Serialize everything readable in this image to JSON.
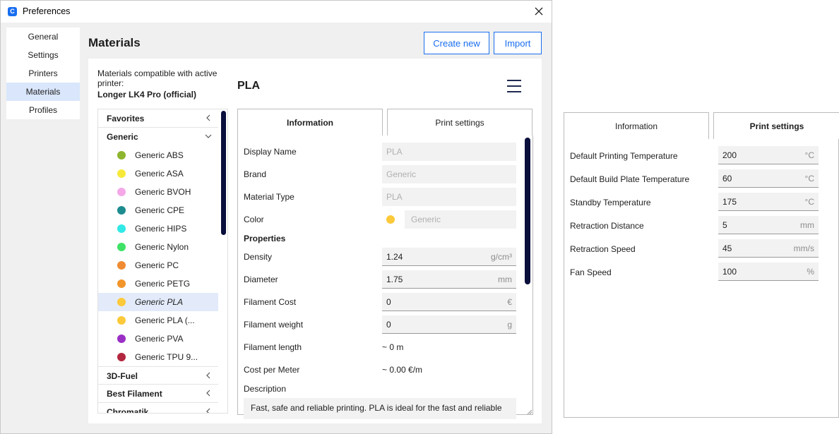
{
  "window": {
    "title": "Preferences",
    "app_icon_glyph": "C"
  },
  "sidebar": {
    "items": [
      {
        "label": "General"
      },
      {
        "label": "Settings"
      },
      {
        "label": "Printers"
      },
      {
        "label": "Materials",
        "active": true
      },
      {
        "label": "Profiles"
      }
    ]
  },
  "header": {
    "title": "Materials",
    "create_new_label": "Create new",
    "import_label": "Import"
  },
  "compat": {
    "label": "Materials compatible with active printer:",
    "printer": "Longer LK4 Pro (official)"
  },
  "material_list": {
    "favorites": "Favorites",
    "generic": "Generic",
    "materials": [
      {
        "name": "Generic ABS",
        "color": "#8db52f"
      },
      {
        "name": "Generic ASA",
        "color": "#f7e93a"
      },
      {
        "name": "Generic BVOH",
        "color": "#f5a8e8"
      },
      {
        "name": "Generic CPE",
        "color": "#1d8c8f"
      },
      {
        "name": "Generic HIPS",
        "color": "#32e9e6"
      },
      {
        "name": "Generic Nylon",
        "color": "#3fe266"
      },
      {
        "name": "Generic PC",
        "color": "#f08b33"
      },
      {
        "name": "Generic PETG",
        "color": "#f2952a"
      },
      {
        "name": "Generic PLA",
        "color": "#fcc93a",
        "active": true
      },
      {
        "name": "Generic PLA (...",
        "color": "#fcc93a"
      },
      {
        "name": "Generic PVA",
        "color": "#9a2fc5"
      },
      {
        "name": "Generic TPU 9...",
        "color": "#b3263f"
      }
    ],
    "brands": [
      "3D-Fuel",
      "Best Filament",
      "Chromatik"
    ]
  },
  "detail": {
    "title": "PLA",
    "tabs": {
      "information": "Information",
      "print_settings": "Print settings"
    },
    "display_name_label": "Display Name",
    "display_name": "PLA",
    "brand_label": "Brand",
    "brand": "Generic",
    "material_type_label": "Material Type",
    "material_type": "PLA",
    "color_label": "Color",
    "color_name": "Generic",
    "color_value": "#fcc93a",
    "properties_heading": "Properties",
    "density_label": "Density",
    "density": "1.24",
    "density_unit": "g/cm³",
    "diameter_label": "Diameter",
    "diameter": "1.75",
    "diameter_unit": "mm",
    "cost_label": "Filament Cost",
    "cost": "0",
    "cost_unit": "€",
    "weight_label": "Filament weight",
    "weight": "0",
    "weight_unit": "g",
    "length_label": "Filament length",
    "length": "~ 0 m",
    "cost_per_meter_label": "Cost per Meter",
    "cost_per_meter": "~ 0.00 €/m",
    "description_label": "Description",
    "description": "Fast, safe and reliable printing. PLA is ideal for the fast and reliable"
  },
  "print_settings_panel": {
    "tabs": {
      "information": "Information",
      "print_settings": "Print settings"
    },
    "rows": [
      {
        "label": "Default Printing Temperature",
        "value": "200",
        "unit": "°C"
      },
      {
        "label": "Default Build Plate Temperature",
        "value": "60",
        "unit": "°C"
      },
      {
        "label": "Standby Temperature",
        "value": "175",
        "unit": "°C"
      },
      {
        "label": "Retraction Distance",
        "value": "5",
        "unit": "mm"
      },
      {
        "label": "Retraction Speed",
        "value": "45",
        "unit": "mm/s"
      },
      {
        "label": "Fan Speed",
        "value": "100",
        "unit": "%"
      }
    ]
  },
  "colors": {
    "accent": "#196ef0",
    "selection": "#e3ebfa",
    "scrollbar": "#0b0f3c"
  }
}
